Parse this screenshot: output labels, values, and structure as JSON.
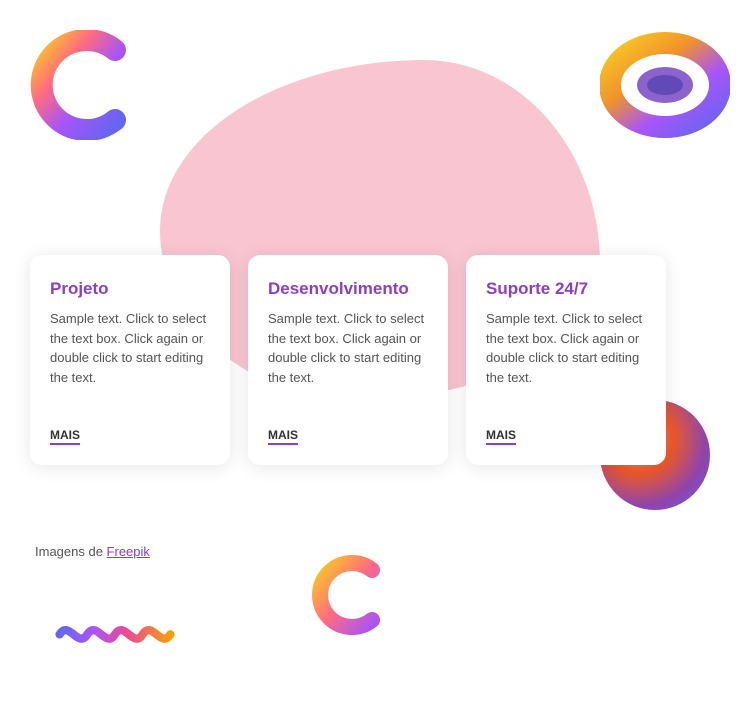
{
  "cards": [
    {
      "id": "projeto",
      "title": "Projeto",
      "text": "Sample text. Click to select the text box. Click again or double click to start editing the text.",
      "link": "MAIS"
    },
    {
      "id": "desenvolvimento",
      "title": "Desenvolvimento",
      "text": "Sample text. Click to select the text box. Click again or double click to start editing the text.",
      "link": "MAIS"
    },
    {
      "id": "suporte",
      "title": "Suporte 24/7",
      "text": "Sample text. Click to select the text box. Click again or double click to start editing the text.",
      "link": "MAIS"
    }
  ],
  "footer": {
    "prefix": "Imagens de ",
    "link_text": "Freepik",
    "link_url": "#"
  }
}
